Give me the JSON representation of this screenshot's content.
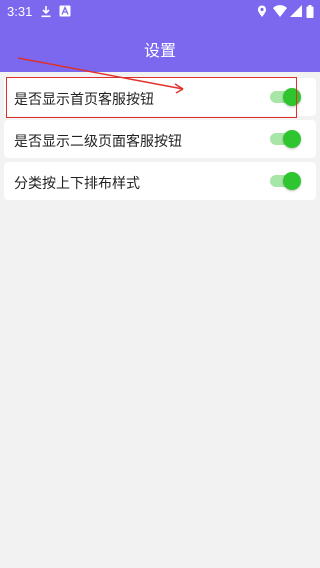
{
  "status_bar": {
    "time": "3:31",
    "icons": [
      "download-icon",
      "a-notification-icon",
      "location-icon",
      "wifi-icon",
      "signal-icon",
      "battery-icon"
    ]
  },
  "app_bar": {
    "title": "设置"
  },
  "settings": [
    {
      "label": "是否显示首页客服按钮",
      "enabled": true
    },
    {
      "label": "是否显示二级页面客服按钮",
      "enabled": true
    },
    {
      "label": "分类按上下排布样式",
      "enabled": true
    }
  ],
  "colors": {
    "accent": "#7b68ee",
    "toggle_on_thumb": "#2ec52e",
    "toggle_on_track": "#a8e6a8",
    "annotation": "#e0302a"
  }
}
